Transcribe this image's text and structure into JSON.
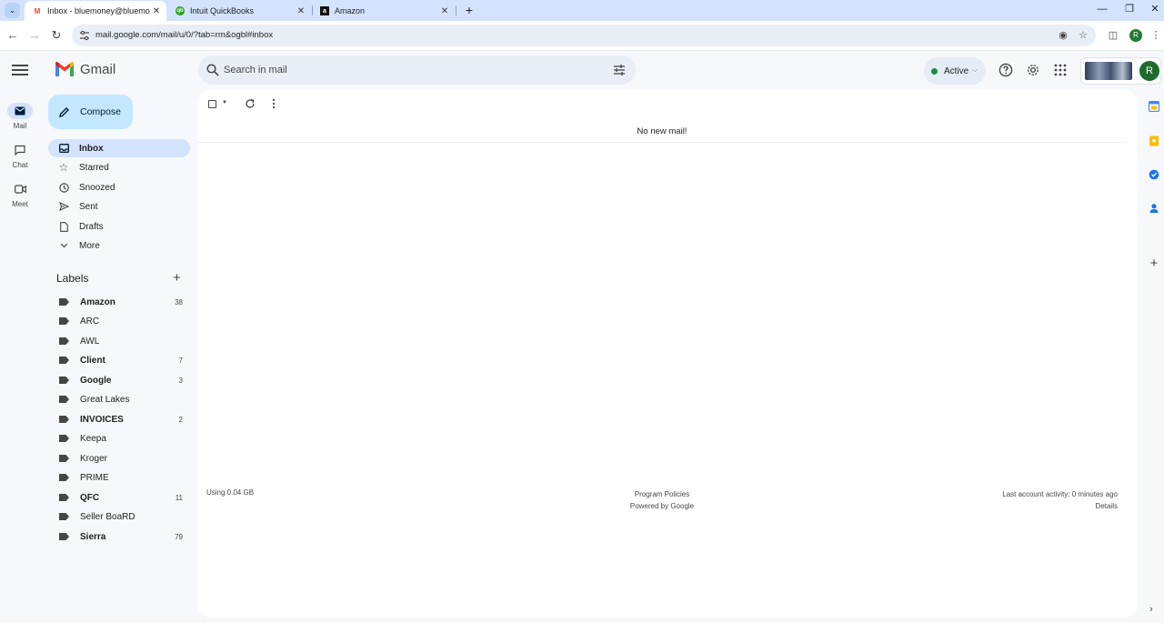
{
  "browser": {
    "tabs": [
      {
        "title": "Inbox - bluemoney@bluemoné",
        "active": true
      },
      {
        "title": "Intuit QuickBooks",
        "active": false
      },
      {
        "title": "Amazon",
        "active": false
      }
    ],
    "url": "mail.google.com/mail/u/0/?tab=rm&ogbl#inbox",
    "profile_initial": "R"
  },
  "app": {
    "name": "Gmail",
    "search_placeholder": "Search in mail",
    "status": "Active",
    "account_initial": "R"
  },
  "rail": [
    {
      "label": "Mail",
      "icon": "mail-icon"
    },
    {
      "label": "Chat",
      "icon": "chat-icon"
    },
    {
      "label": "Meet",
      "icon": "meet-icon"
    }
  ],
  "compose_label": "Compose",
  "nav": [
    {
      "label": "Inbox",
      "icon": "inbox-icon",
      "active": true
    },
    {
      "label": "Starred",
      "icon": "star-icon"
    },
    {
      "label": "Snoozed",
      "icon": "clock-icon"
    },
    {
      "label": "Sent",
      "icon": "send-icon"
    },
    {
      "label": "Drafts",
      "icon": "draft-icon"
    },
    {
      "label": "More",
      "icon": "chevron-down-icon"
    }
  ],
  "labels_title": "Labels",
  "labels": [
    {
      "name": "Amazon",
      "count": "38",
      "bold": true
    },
    {
      "name": "ARC",
      "count": "",
      "bold": false
    },
    {
      "name": "AWL",
      "count": "",
      "bold": false
    },
    {
      "name": "Client",
      "count": "7",
      "bold": true
    },
    {
      "name": "Google",
      "count": "3",
      "bold": true
    },
    {
      "name": "Great Lakes",
      "count": "",
      "bold": false
    },
    {
      "name": "INVOICES",
      "count": "2",
      "bold": true
    },
    {
      "name": "Keepa",
      "count": "",
      "bold": false
    },
    {
      "name": "Kroger",
      "count": "",
      "bold": false
    },
    {
      "name": "PRIME",
      "count": "",
      "bold": false
    },
    {
      "name": "QFC",
      "count": "11",
      "bold": true
    },
    {
      "name": "Seller BoaRD",
      "count": "",
      "bold": false
    },
    {
      "name": "Sierra",
      "count": "79",
      "bold": true
    }
  ],
  "main": {
    "empty_message": "No new mail!",
    "storage": "Using 0.04 GB",
    "policies": "Program Policies",
    "powered": "Powered by Google",
    "last_activity": "Last account activity: 0 minutes ago",
    "details": "Details"
  }
}
